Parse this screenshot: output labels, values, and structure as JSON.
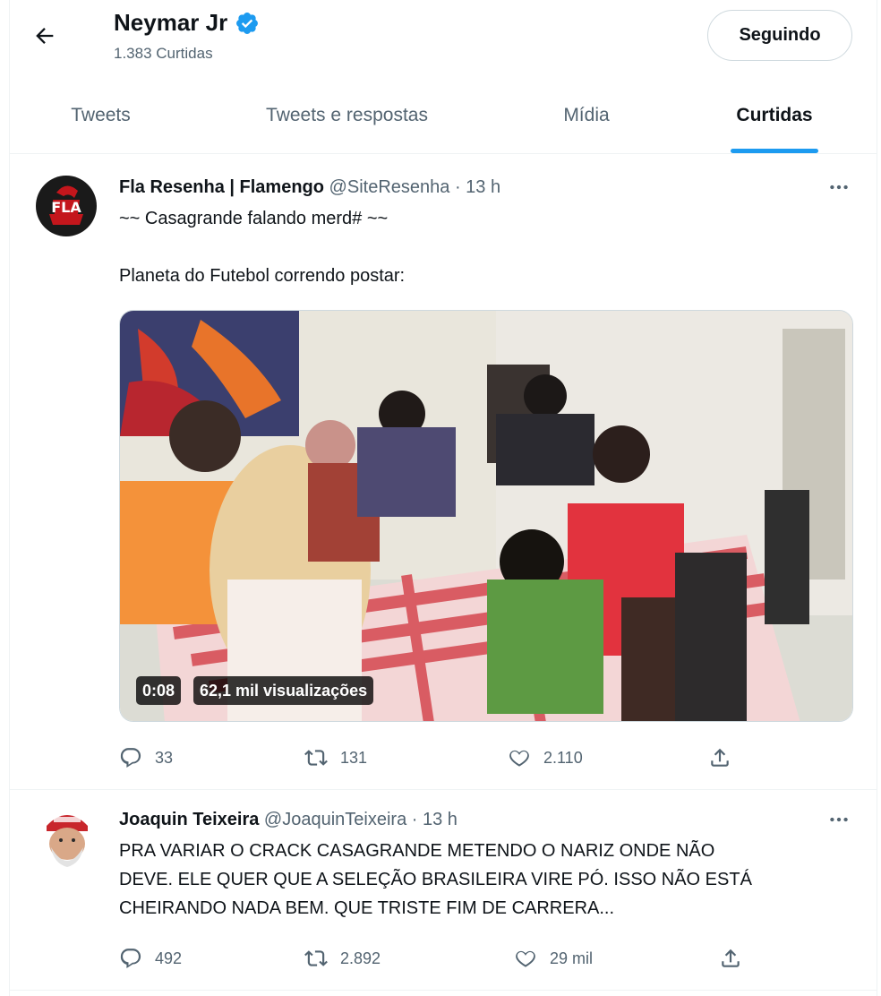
{
  "header": {
    "name": "Neymar Jr",
    "likes_count": "1.383 Curtidas",
    "follow_button": "Seguindo"
  },
  "tabs": [
    {
      "label": "Tweets",
      "active": false
    },
    {
      "label": "Tweets e respostas",
      "active": false
    },
    {
      "label": "Mídia",
      "active": false
    },
    {
      "label": "Curtidas",
      "active": true
    }
  ],
  "tweets": [
    {
      "display_name": "Fla Resenha | Flamengo",
      "handle": "@SiteResenha",
      "time": "13 h",
      "avatar_text": "FLA",
      "lines": [
        "~~ Casagrande falando merd# ~~",
        "Planeta do Futebol correndo postar:"
      ],
      "video": {
        "duration": "0:08",
        "views": "62,1 mil visualizações"
      },
      "stats": {
        "replies": "33",
        "retweets": "131",
        "likes": "2.110"
      }
    },
    {
      "display_name": "Joaquin Teixeira",
      "handle": "@JoaquinTeixeira",
      "time": "13 h",
      "lines": [
        "PRA VARIAR O CRACK CASAGRANDE METENDO O NARIZ ONDE NÃO",
        "DEVE. ELE QUER QUE A SELEÇÃO BRASILEIRA VIRE PÓ. ISSO NÃO ESTÁ",
        "CHEIRANDO NADA BEM. QUE TRISTE FIM DE CARRERA..."
      ],
      "stats": {
        "replies": "492",
        "retweets": "2.892",
        "likes": "29 mil"
      }
    }
  ],
  "colors": {
    "accent": "#1d9bf0",
    "text": "#0f1419",
    "muted": "#536471",
    "border": "#cfd9de"
  },
  "icons": [
    "back-arrow-icon",
    "verified-badge-icon",
    "more-icon",
    "reply-icon",
    "retweet-icon",
    "like-icon",
    "share-icon"
  ]
}
